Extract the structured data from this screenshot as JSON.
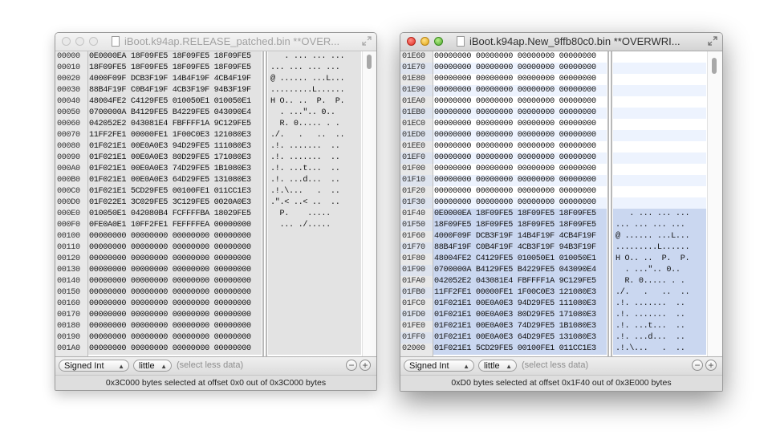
{
  "windows": [
    {
      "title": "iBoot.k94ap.RELEASE_patched.bin **OVER...",
      "offsets": [
        "00000",
        "00010",
        "00020",
        "00030",
        "00040",
        "00050",
        "00060",
        "00070",
        "00080",
        "00090",
        "000A0",
        "000B0",
        "000C0",
        "000D0",
        "000E0",
        "000F0",
        "00100",
        "00110",
        "00120",
        "00130",
        "00140",
        "00150",
        "00160",
        "00170",
        "00180",
        "00190",
        "001A0"
      ],
      "hex": [
        "0E0000EA 18F09FE5 18F09FE5 18F09FE5",
        "18F09FE5 18F09FE5 18F09FE5 18F09FE5",
        "4000F09F DCB3F19F 14B4F19F 4CB4F19F",
        "88B4F19F C0B4F19F 4CB3F19F 94B3F19F",
        "48004FE2 C4129FE5 010050E1 010050E1",
        "0700000A B4129FE5 B4229FE5 043090E4",
        "042052E2 043081E4 FBFFFF1A 9C129FE5",
        "11FF2FE1 00000FE1 1F00C0E3 121080E3",
        "01F021E1 00E0A0E3 94D29FE5 111080E3",
        "01F021E1 00E0A0E3 80D29FE5 171080E3",
        "01F021E1 00E0A0E3 74D29FE5 1B1080E3",
        "01F021E1 00E0A0E3 64D29FE5 131080E3",
        "01F021E1 5CD29FE5 00100FE1 011CC1E3",
        "01F022E1 3C029FE5 3C129FE5 0020A0E3",
        "010050E1 042080B4 FCFFFFBA 18029FE5",
        "0FE0A0E1 10FF2FE1 FEFFFFEA 00000000",
        "00000000 00000000 00000000 00000000",
        "00000000 00000000 00000000 00000000",
        "00000000 00000000 00000000 00000000",
        "00000000 00000000 00000000 00000000",
        "00000000 00000000 00000000 00000000",
        "00000000 00000000 00000000 00000000",
        "00000000 00000000 00000000 00000000",
        "00000000 00000000 00000000 00000000",
        "00000000 00000000 00000000 00000000",
        "00000000 00000000 00000000 00000000",
        "00000000 00000000 00000000 00000000"
      ],
      "ascii": [
        "   . ... ... ...",
        "... ... ... ...",
        "@ ...... ...L...",
        ".........L......",
        "H O.. ..  P.  P.",
        "  . ...\".. 0..",
        "  R. 0..... . .",
        "./.   .   ..  ..",
        ".!. .......  ..",
        ".!. .......  ..",
        ".!. ...t...  ..",
        ".!. ...d...  ..",
        ".!.\\...   .  ..",
        ".\".< ..< ..  ..",
        "  P.    .....",
        "  ... ./.....",
        "",
        "",
        "",
        "",
        "",
        "",
        "",
        "",
        "",
        "",
        ""
      ],
      "bottom": {
        "type_select": "Signed Int",
        "endian_select": "little",
        "hint": "(select less data)"
      },
      "status": "0x3C000 bytes selected at offset 0x0 out of 0x3C000 bytes"
    },
    {
      "title": "iBoot.k94ap.New_9ffb80c0.bin **OVERWRI...",
      "offsets": [
        "01E60",
        "01E70",
        "01E80",
        "01E90",
        "01EA0",
        "01EB0",
        "01EC0",
        "01ED0",
        "01EE0",
        "01EF0",
        "01F00",
        "01F10",
        "01F20",
        "01F30",
        "01F40",
        "01F50",
        "01F60",
        "01F70",
        "01F80",
        "01F90",
        "01FA0",
        "01FB0",
        "01FC0",
        "01FD0",
        "01FE0",
        "01FF0",
        "02000"
      ],
      "hex": [
        "00000000 00000000 00000000 00000000",
        "00000000 00000000 00000000 00000000",
        "00000000 00000000 00000000 00000000",
        "00000000 00000000 00000000 00000000",
        "00000000 00000000 00000000 00000000",
        "00000000 00000000 00000000 00000000",
        "00000000 00000000 00000000 00000000",
        "00000000 00000000 00000000 00000000",
        "00000000 00000000 00000000 00000000",
        "00000000 00000000 00000000 00000000",
        "00000000 00000000 00000000 00000000",
        "00000000 00000000 00000000 00000000",
        "00000000 00000000 00000000 00000000",
        "00000000 00000000 00000000 00000000",
        "0E0000EA 18F09FE5 18F09FE5 18F09FE5",
        "18F09FE5 18F09FE5 18F09FE5 18F09FE5",
        "4000F09F DCB3F19F 14B4F19F 4CB4F19F",
        "88B4F19F C0B4F19F 4CB3F19F 94B3F19F",
        "48004FE2 C4129FE5 010050E1 010050E1",
        "0700000A B4129FE5 B4229FE5 043090E4",
        "042052E2 043081E4 FBFFFF1A 9C129FE5",
        "11FF2FE1 00000FE1 1F00C0E3 121080E3",
        "01F021E1 00E0A0E3 94D29FE5 111080E3",
        "01F021E1 00E0A0E3 80D29FE5 171080E3",
        "01F021E1 00E0A0E3 74D29FE5 1B1080E3",
        "01F021E1 00E0A0E3 64D29FE5 131080E3",
        "01F021E1 5CD29FE5 00100FE1 011CC1E3"
      ],
      "ascii": [
        "",
        "",
        "",
        "",
        "",
        "",
        "",
        "",
        "",
        "",
        "",
        "",
        "",
        "",
        "   . ... ... ...",
        "... ... ... ...",
        "@ ...... ...L...",
        ".........L......",
        "H O.. ..  P.  P.",
        "  . ...\".. 0..",
        "  R. 0..... . .",
        "./.   .   ..  ..",
        ".!. .......  ..",
        ".!. .......  ..",
        ".!. ...t...  ..",
        ".!. ...d...  ..",
        ".!.\\...   .  .."
      ],
      "bottom": {
        "type_select": "Signed Int",
        "endian_select": "little",
        "hint": "(select less data)"
      },
      "status": "0xD0 bytes selected at offset 0x1F40 out of 0x3E000 bytes"
    }
  ],
  "icons": {
    "document": "document-icon",
    "resize": "fullscreen-arrows-icon",
    "remove": "minus-icon",
    "add": "plus-icon",
    "popup_arrow": "up-down-arrows-icon"
  },
  "colors": {
    "selection_active": "#cad7f0",
    "selection_inactive": "#e3e3e3",
    "stripe": "#edf3fe",
    "close_red": "#e02d22",
    "minimize_yellow": "#e2a410",
    "zoom_green": "#4ca62c"
  }
}
